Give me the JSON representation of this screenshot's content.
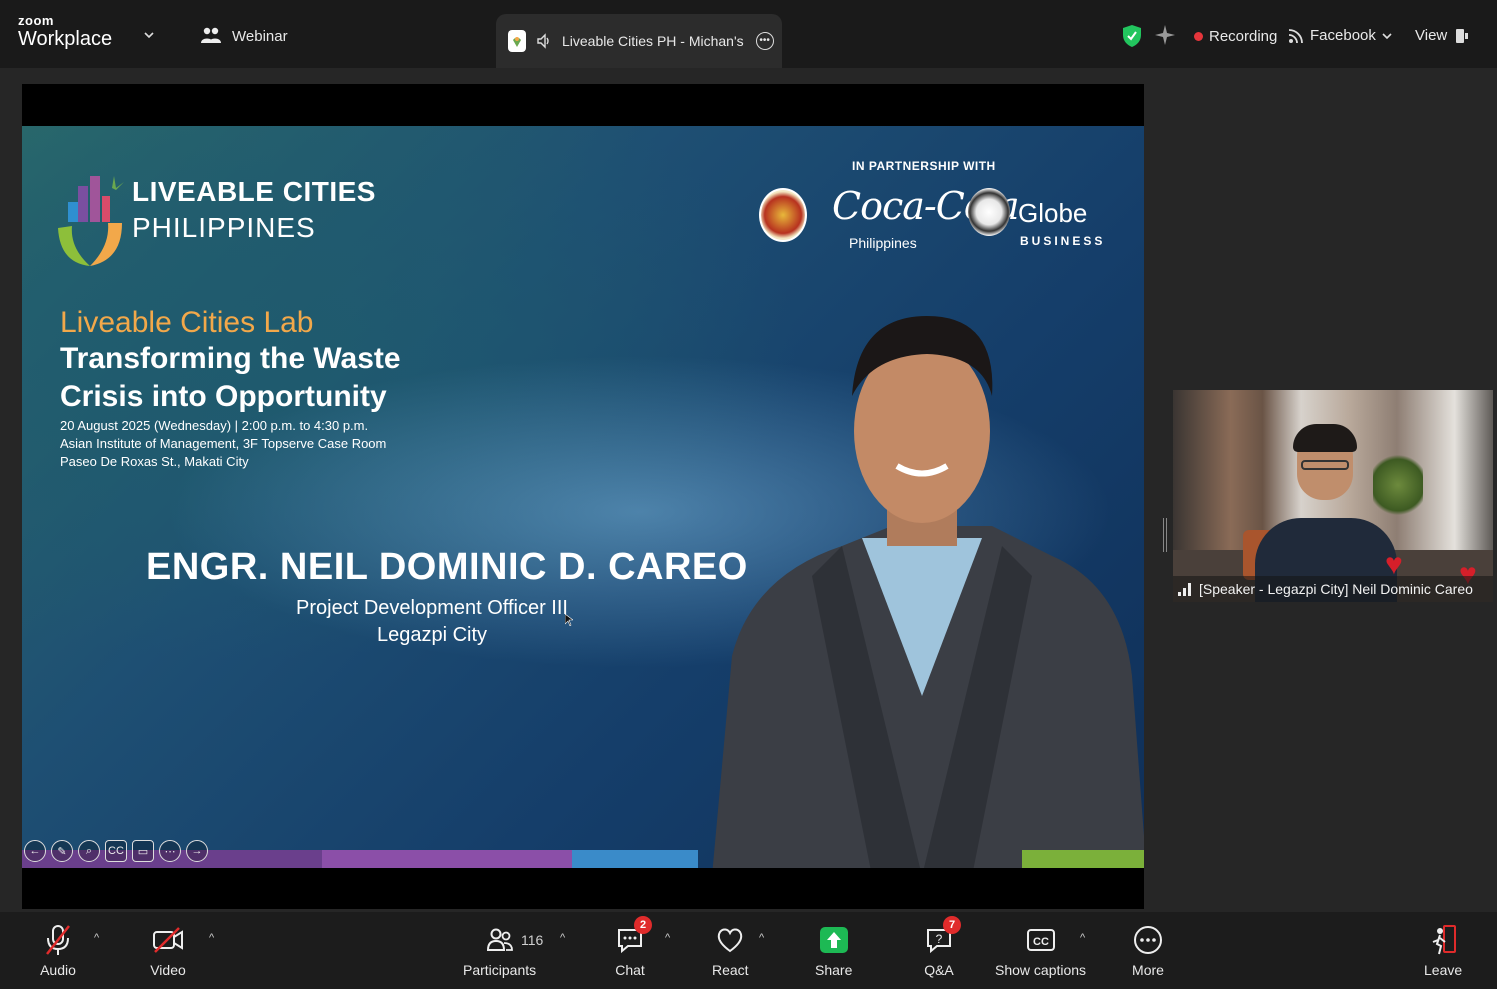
{
  "topbar": {
    "brand_small": "zoom",
    "brand_large": "Workplace",
    "webinar_label": "Webinar",
    "tab_title": "Liveable Cities PH - Michan's",
    "recording_label": "Recording",
    "stream_label": "Facebook",
    "view_label": "View"
  },
  "slide": {
    "org_title": "LIVEABLE CITIES",
    "org_subtitle": "PHILIPPINES",
    "partner_label": "IN PARTNERSHIP WITH",
    "partner_coke": "Coca-Cola",
    "partner_coke_sub": "Philippines",
    "partner_globe": "Globe",
    "partner_globe_sub": "BUSINESS",
    "lab_title": "Liveable Cities Lab",
    "talk_title": "Transforming the Waste Crisis into Opportunity",
    "event_line1": "20 August 2025 (Wednesday) | 2:00 p.m. to 4:30 p.m.",
    "event_line2": "Asian Institute of Management, 3F Topserve Case Room",
    "event_line3": "Paseo De Roxas St., Makati City",
    "speaker_name": "ENGR. NEIL DOMINIC D. CAREO",
    "speaker_role": "Project Development Officer III",
    "speaker_city": "Legazpi City"
  },
  "video": {
    "label": "[Speaker - Legazpi City] Neil Dominic Careo"
  },
  "toolbar": {
    "audio": "Audio",
    "video": "Video",
    "participants": "Participants",
    "participants_count": "116",
    "chat": "Chat",
    "chat_badge": "2",
    "react": "React",
    "share": "Share",
    "qa": "Q&A",
    "qa_badge": "7",
    "captions": "Show captions",
    "more": "More",
    "leave": "Leave"
  },
  "colors": {
    "recording": "#e5353b",
    "share": "#1db954",
    "badge": "#e02b2b",
    "shield": "#22c55e"
  }
}
